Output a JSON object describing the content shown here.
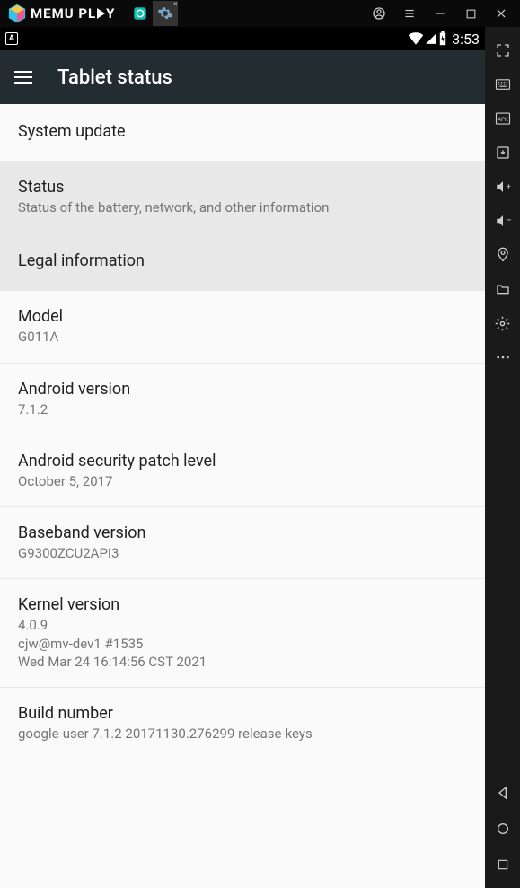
{
  "memu": {
    "brand_prefix": "MEMU",
    "brand_suffix": "PL",
    "brand_suffix2": "Y"
  },
  "status_bar": {
    "time": "3:53"
  },
  "app_bar": {
    "title": "Tablet status"
  },
  "items": [
    {
      "title": "System update",
      "sub": ""
    },
    {
      "title": "Status",
      "sub": "Status of the battery, network, and other information"
    },
    {
      "title": "Legal information",
      "sub": ""
    },
    {
      "title": "Model",
      "sub": "G011A"
    },
    {
      "title": "Android version",
      "sub": "7.1.2"
    },
    {
      "title": "Android security patch level",
      "sub": "October 5, 2017"
    },
    {
      "title": "Baseband version",
      "sub": "G9300ZCU2API3"
    },
    {
      "title": "Kernel version",
      "sub": "4.0.9\ncjw@mv-dev1 #1535\nWed Mar 24 16:14:56 CST 2021"
    },
    {
      "title": "Build number",
      "sub": "google-user 7.1.2 20171130.276299 release-keys"
    }
  ]
}
